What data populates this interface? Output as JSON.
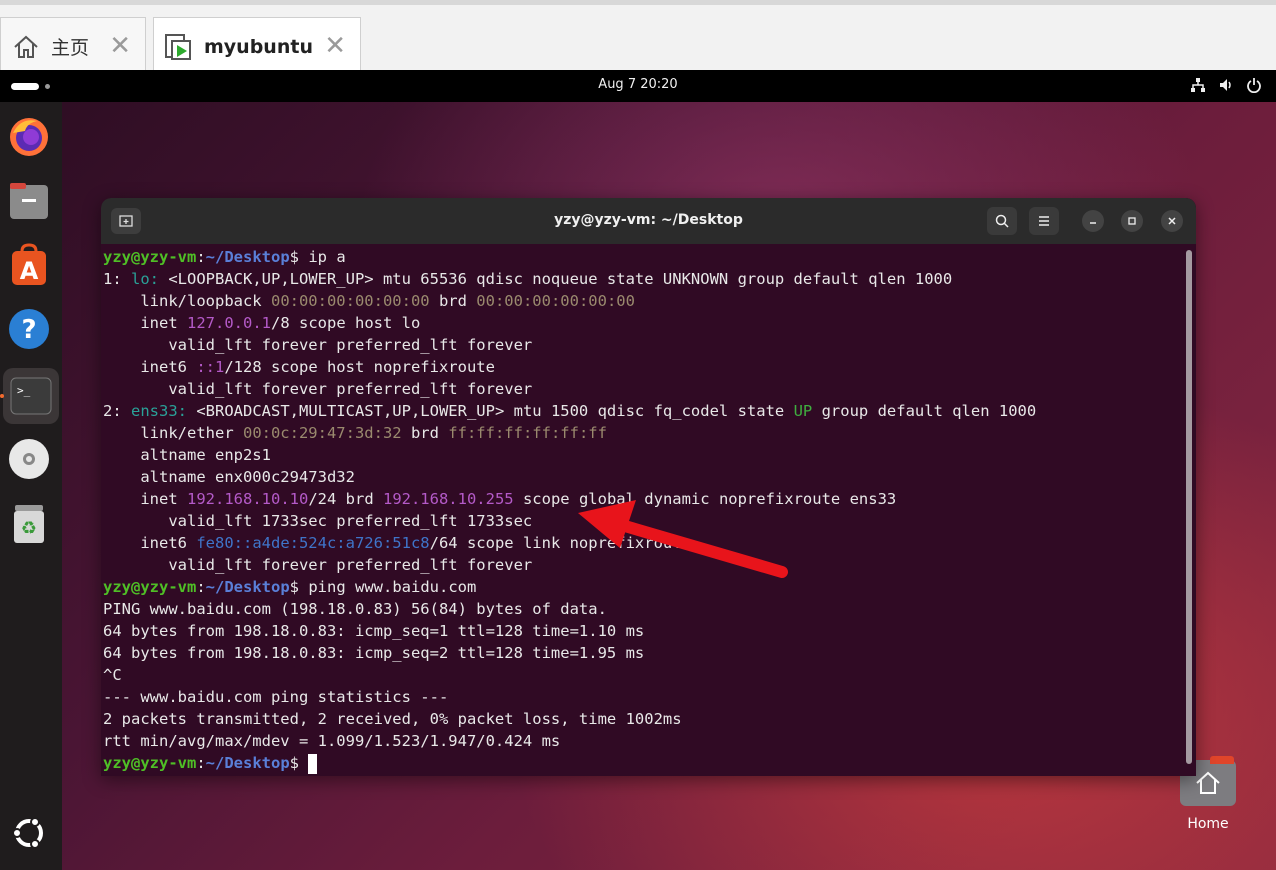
{
  "host_tabs": [
    {
      "label": "主页",
      "icon": "home-icon"
    },
    {
      "label": "myubuntu",
      "icon": "vm-icon"
    }
  ],
  "topbar": {
    "clock": "Aug 7  20:20"
  },
  "dock": {
    "items": [
      "firefox-icon",
      "files-icon",
      "app-center-icon",
      "help-icon",
      "terminal-icon",
      "disc-icon",
      "trash-icon"
    ],
    "show_apps": "ubuntu-logo-icon"
  },
  "desktop": {
    "home_label": "Home"
  },
  "terminal": {
    "title": "yzy@yzy-vm: ~/Desktop",
    "prompt": {
      "user": "yzy@yzy-vm",
      "sep": ":",
      "path": "~/Desktop",
      "sign": "$ "
    },
    "cmd1": "ip a",
    "lo": {
      "idx": "1: ",
      "name": "lo:",
      "flags": " <LOOPBACK,UP,LOWER_UP> mtu 65536 qdisc noqueue state UNKNOWN group default qlen 1000",
      "link_pre": "    link/loopback ",
      "mac": "00:00:00:00:00:00",
      "brd": " brd ",
      "brd_mac": "00:00:00:00:00:00",
      "inet_pre": "    inet ",
      "ip": "127.0.0.1",
      "inet_post": "/8 scope host lo",
      "valid1": "       valid_lft forever preferred_lft forever",
      "inet6_pre": "    inet6 ",
      "ip6": "::1",
      "inet6_post": "/128 scope host noprefixroute",
      "valid2": "       valid_lft forever preferred_lft forever"
    },
    "ens": {
      "idx": "2: ",
      "name": "ens33:",
      "flags": " <BROADCAST,MULTICAST,UP,LOWER_UP> mtu 1500 qdisc fq_codel state ",
      "state": "UP",
      "flags_post": " group default qlen 1000",
      "link_pre": "    link/ether ",
      "mac": "00:0c:29:47:3d:32",
      "brd": " brd ",
      "brd_mac": "ff:ff:ff:ff:ff:ff",
      "alt1": "    altname enp2s1",
      "alt2": "    altname enx000c29473d32",
      "inet_pre": "    inet ",
      "ip": "192.168.10.10",
      "inet_mid": "/24 brd ",
      "bcast": "192.168.10.255",
      "inet_post": " scope global dynamic noprefixroute ens33",
      "valid1": "       valid_lft 1733sec preferred_lft 1733sec",
      "inet6_pre": "    inet6 ",
      "ip6": "fe80::a4de:524c:a726:51c8",
      "inet6_post": "/64 scope link noprefixroute",
      "valid2": "       valid_lft forever preferred_lft forever"
    },
    "cmd2": "ping www.baidu.com",
    "ping": [
      "PING www.baidu.com (198.18.0.83) 56(84) bytes of data.",
      "64 bytes from 198.18.0.83: icmp_seq=1 ttl=128 time=1.10 ms",
      "64 bytes from 198.18.0.83: icmp_seq=2 ttl=128 time=1.95 ms",
      "^C",
      "--- www.baidu.com ping statistics ---",
      "2 packets transmitted, 2 received, 0% packet loss, time 1002ms",
      "rtt min/avg/max/mdev = 1.099/1.523/1.947/0.424 ms"
    ]
  },
  "colors": {
    "annotation_arrow": "#e8141b",
    "terminal_bg": "#300a24",
    "prompt_user": "#4fbf26",
    "prompt_path": "#5a7fd8"
  }
}
